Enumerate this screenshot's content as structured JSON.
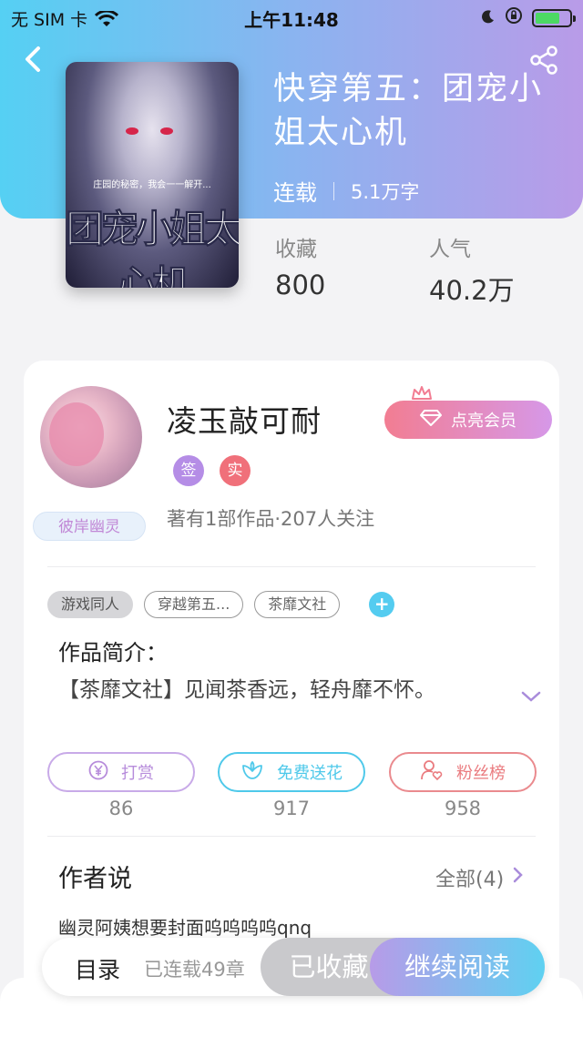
{
  "status_bar": {
    "carrier": "无 SIM 卡",
    "time": "上午11:48"
  },
  "book": {
    "title": "快穿第五：团宠小姐太心机",
    "status": "连载",
    "word_count": "5.1万字",
    "cover_art_text": "团宠小姐太心机",
    "cover_tagline": "庄园的秘密，我会一一解开..."
  },
  "stats": {
    "favorites_label": "收藏",
    "favorites_value": "800",
    "popularity_label": "人气",
    "popularity_value": "40.2万"
  },
  "author": {
    "name": "凌玉敲可耐",
    "badge": "彼岸幽灵",
    "vip_button": "点亮会员",
    "tag_signed": "签",
    "tag_verified": "实",
    "summary": "著有1部作品·207人关注"
  },
  "tags": [
    "游戏同人",
    "穿越第五...",
    "茶靡文社"
  ],
  "intro": {
    "heading": "作品简介：",
    "text": "【茶靡文社】见闻茶香远，轻舟靡不怀。"
  },
  "actions": [
    {
      "label": "打赏",
      "count": "86",
      "color": "#b78cdb"
    },
    {
      "label": "免费送花",
      "count": "917",
      "color": "#4fc9ea"
    },
    {
      "label": "粉丝榜",
      "count": "958",
      "color": "#ea7b7f"
    }
  ],
  "author_says": {
    "heading": "作者说",
    "all_label": "全部(4)",
    "text": "幽灵阿姨想要封面呜呜呜呜qnq"
  },
  "bottom_bar": {
    "toc": "目录",
    "serial": "已连载49章",
    "collected": "已收藏",
    "continue_reading": "继续阅读"
  },
  "colors": {
    "header_gradient_start": "#55d0f3",
    "header_gradient_end": "#b99be8",
    "vip_gradient_start": "#f27d92",
    "vip_gradient_end": "#d698e8",
    "tag_signed_color": "#b58de6",
    "tag_verified_color": "#f0707a"
  }
}
